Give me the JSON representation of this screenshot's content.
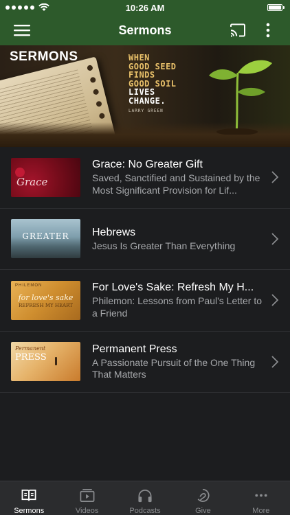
{
  "status_bar": {
    "time": "10:26 AM"
  },
  "header": {
    "title": "Sermons"
  },
  "banner": {
    "label": "SERMONS",
    "quote_line1": "WHEN",
    "quote_line2": "GOOD SEED",
    "quote_line3": "FINDS",
    "quote_line4": "GOOD SOIL",
    "quote_line5": "LIVES",
    "quote_line6": "CHANGE.",
    "author": "LARRY GREEN"
  },
  "sermons": [
    {
      "title": "Grace: No Greater Gift",
      "subtitle": "Saved, Sanctified and Sustained by the Most Significant Provision for Lif...",
      "thumb_text": "Grace"
    },
    {
      "title": "Hebrews",
      "subtitle": "Jesus Is Greater Than Everything",
      "thumb_text": "GREATER"
    },
    {
      "title": "For Love's Sake: Refresh My H...",
      "subtitle": "Philemon: Lessons from Paul's Letter to a Friend",
      "thumb_text": "for love's sake",
      "thumb_text2": "REFRESH MY HEART",
      "thumb_text3": "PHILEMON"
    },
    {
      "title": "Permanent Press",
      "subtitle": "A Passionate Pursuit of the One Thing That Matters",
      "thumb_text": "Permanent",
      "thumb_text2": "PRESS"
    }
  ],
  "tabs": [
    {
      "label": "Sermons",
      "icon": "book-icon",
      "active": true
    },
    {
      "label": "Videos",
      "icon": "video-icon",
      "active": false
    },
    {
      "label": "Podcasts",
      "icon": "headphones-icon",
      "active": false
    },
    {
      "label": "Give",
      "icon": "give-icon",
      "active": false
    },
    {
      "label": "More",
      "icon": "more-icon",
      "active": false
    }
  ],
  "colors": {
    "header_green": "#2d5a2b",
    "background": "#1c1d1f",
    "tab_bar": "#2b2c2e"
  }
}
